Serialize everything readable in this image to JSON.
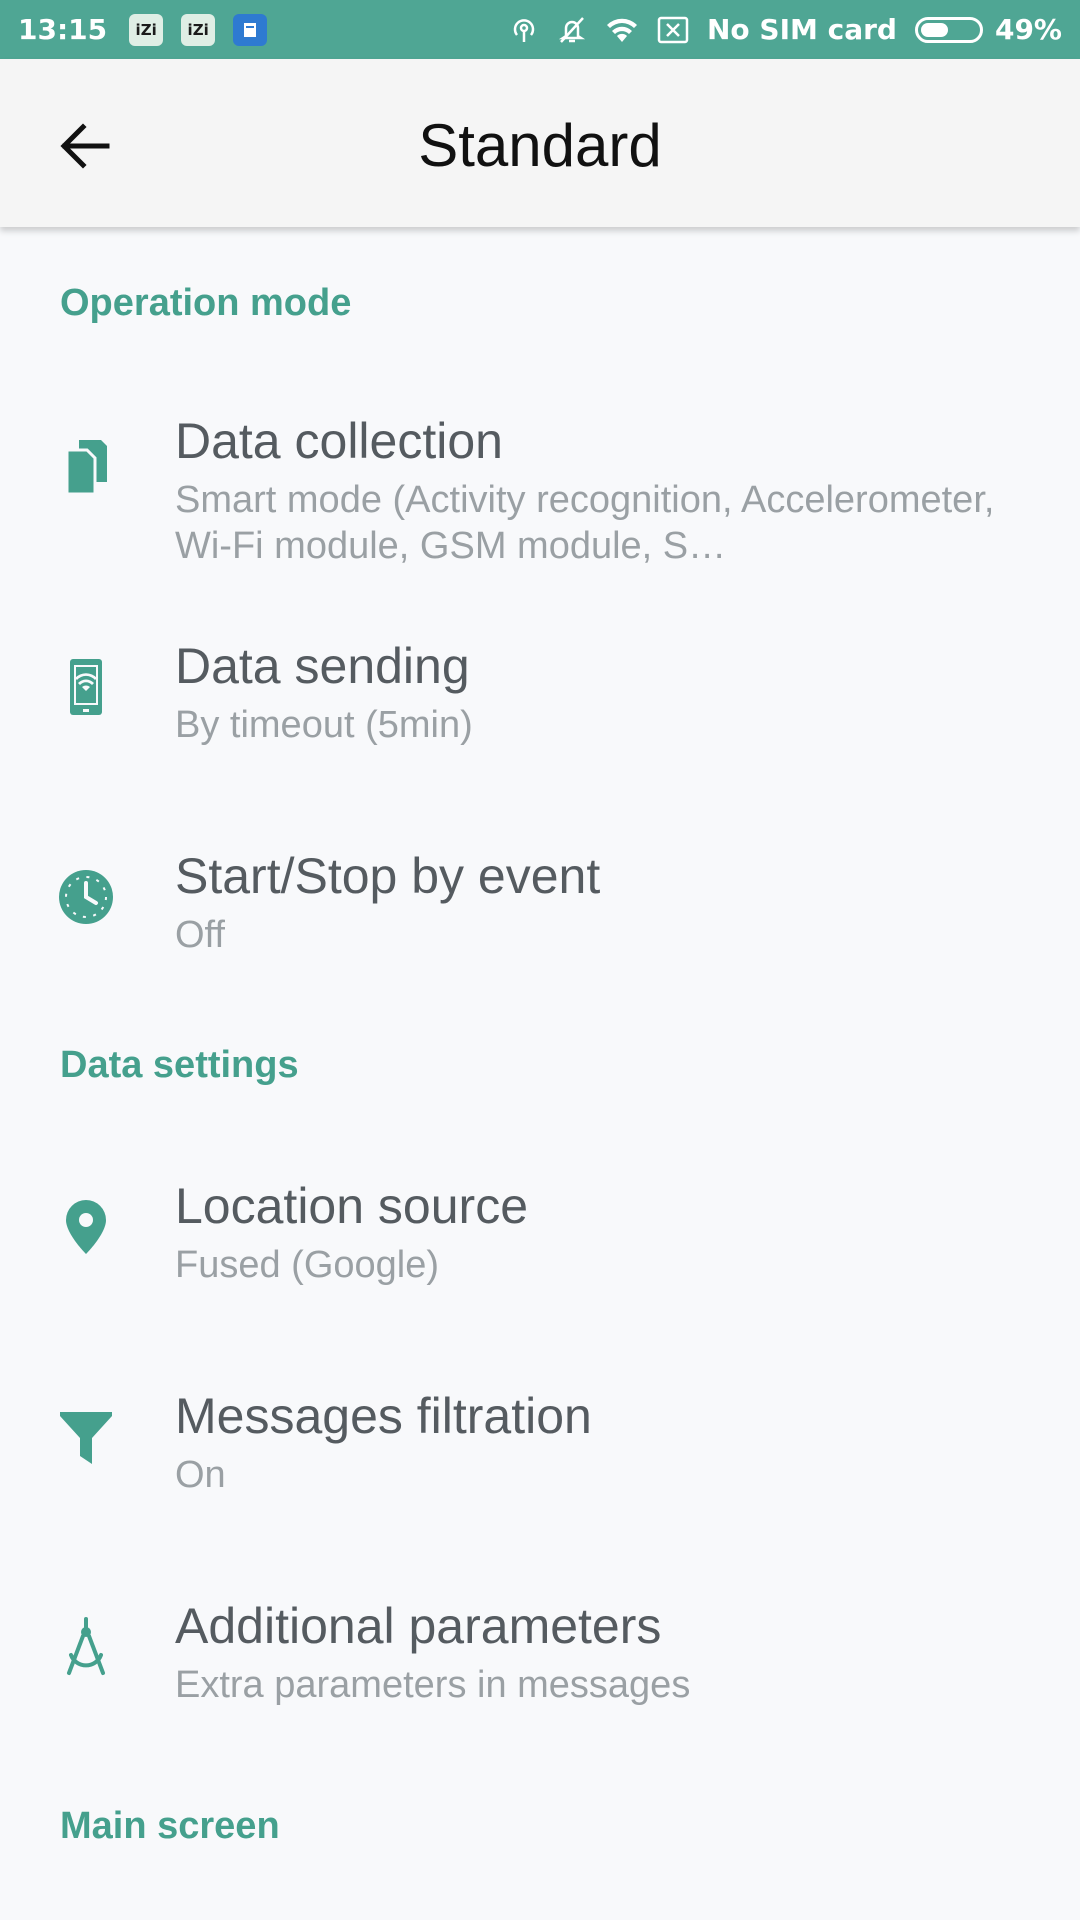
{
  "status_bar": {
    "time": "13:15",
    "apps": [
      "iZi",
      "iZi"
    ],
    "carrier": "No SIM card",
    "battery_level": 0.49,
    "battery_percent": "49%"
  },
  "app_bar": {
    "title": "Standard",
    "back_icon": "arrow-left-icon"
  },
  "accent_color": "#45a08d",
  "status_bar_color": "#4fa694",
  "sections": [
    {
      "header": "Operation mode",
      "items": [
        {
          "icon": "documents-icon",
          "title": "Data collection",
          "subtitle": "Smart mode (Activity recognition, Accelerometer, Wi-Fi module, GSM module, S…"
        },
        {
          "icon": "phone-wifi-icon",
          "title": "Data sending",
          "subtitle": "By timeout (5min)"
        },
        {
          "icon": "clock-icon",
          "title": "Start/Stop by event",
          "subtitle": "Off"
        }
      ]
    },
    {
      "header": "Data settings",
      "items": [
        {
          "icon": "location-pin-icon",
          "title": "Location source",
          "subtitle": "Fused (Google)"
        },
        {
          "icon": "filter-icon",
          "title": "Messages filtration",
          "subtitle": "On"
        },
        {
          "icon": "compass-drafting-icon",
          "title": "Additional parameters",
          "subtitle": "Extra parameters in messages"
        }
      ]
    },
    {
      "header": "Main screen",
      "items": []
    }
  ]
}
